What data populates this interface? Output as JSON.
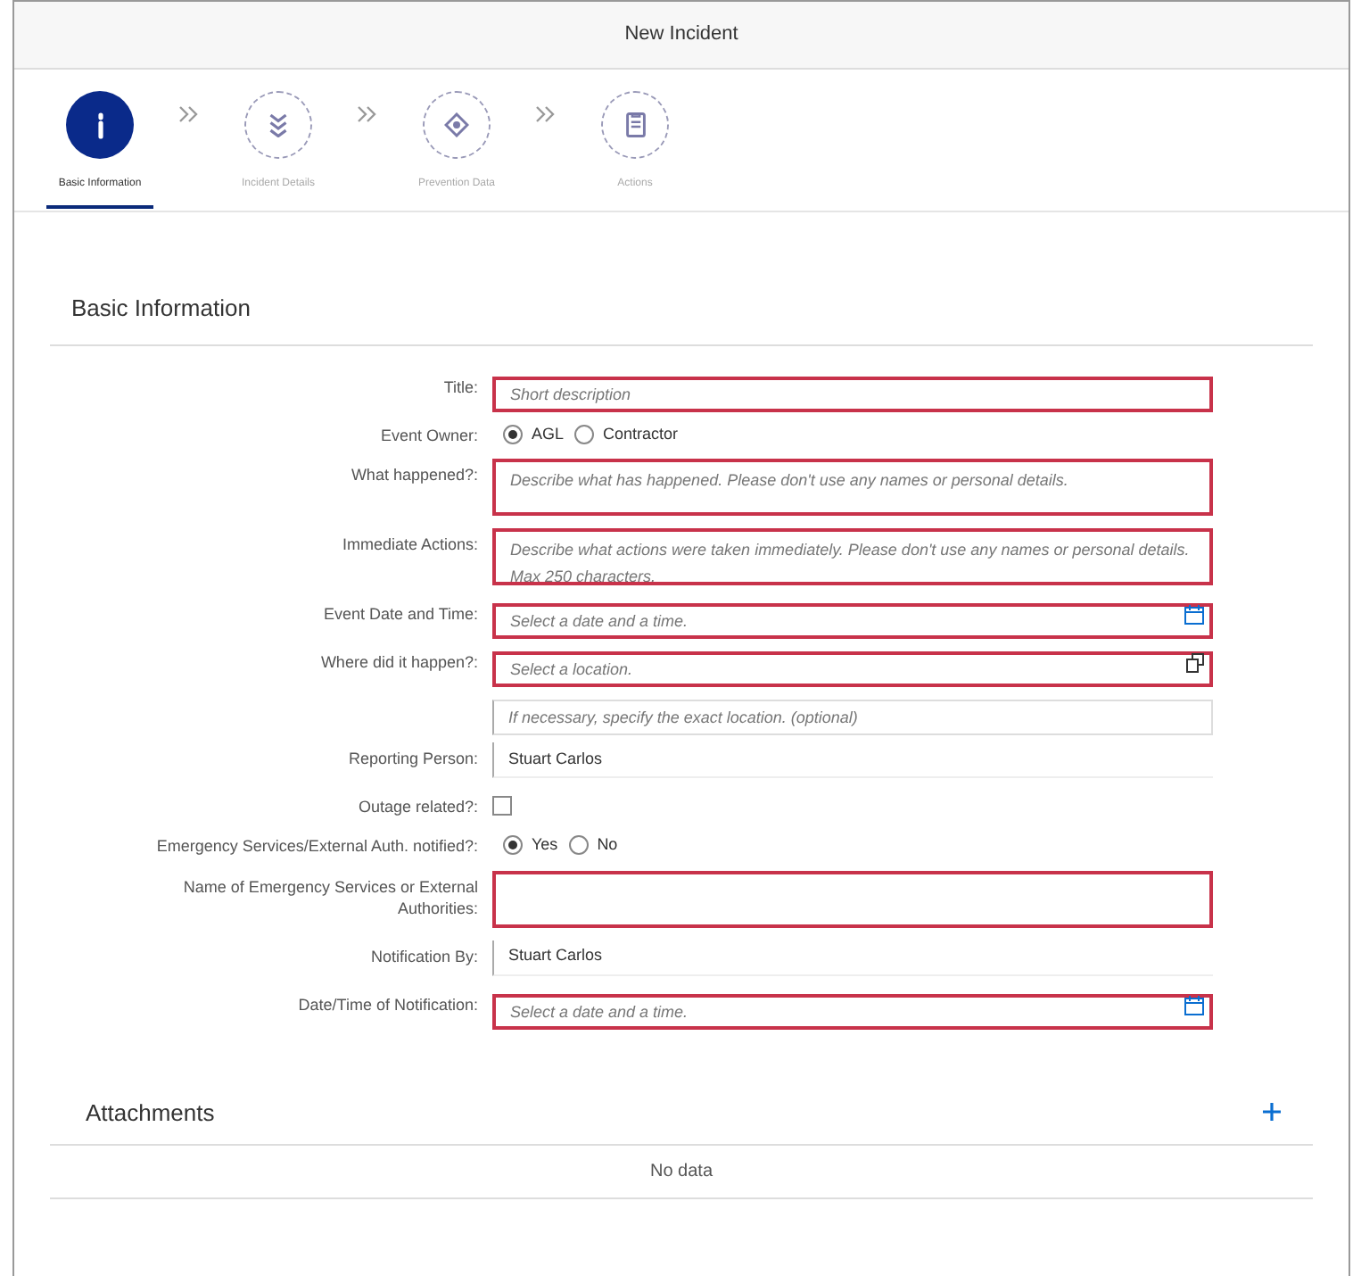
{
  "window": {
    "title": "New Incident"
  },
  "steps": [
    {
      "label": "Basic Information",
      "selected": true
    },
    {
      "label": "Incident Details",
      "selected": false
    },
    {
      "label": "Prevention Data",
      "selected": false
    },
    {
      "label": "Actions",
      "selected": false
    }
  ],
  "section": {
    "title": "Basic Information"
  },
  "fields": [
    {
      "kind": "text",
      "label": "Title:",
      "placeholder": "Short description",
      "invalid": true
    },
    {
      "kind": "radio",
      "label": "Event Owner:",
      "options": [
        {
          "label": "AGL",
          "selected": true
        },
        {
          "label": "Contractor",
          "selected": false
        }
      ]
    },
    {
      "kind": "textarea",
      "label": "What happened?:",
      "placeholder": "Describe what has happened. Please don't use any names or personal details.",
      "invalid": true
    },
    {
      "kind": "textarea",
      "label": "Immediate Actions:",
      "placeholder": "Describe what actions were taken immediately. Please don't use any names or personal details. Max 250 characters.",
      "invalid": true
    },
    {
      "kind": "date",
      "label": "Event Date and Time:",
      "placeholder": "Select a date and a time.",
      "invalid": true
    },
    {
      "kind": "location",
      "label": "Where did it happen?:",
      "placeholder": "Select a location.",
      "invalid": true
    },
    {
      "kind": "text",
      "placeholder": "If necessary, specify the exact location. (optional)",
      "invalid": false
    },
    {
      "kind": "readonly",
      "label": "Reporting Person:",
      "value": "Stuart Carlos"
    },
    {
      "kind": "checkbox",
      "label": "Outage related?:",
      "checked": false
    },
    {
      "kind": "radio",
      "label": "Emergency Services/External Auth. notified?:",
      "options": [
        {
          "label": "Yes",
          "selected": true
        },
        {
          "label": "No",
          "selected": false
        }
      ]
    },
    {
      "kind": "textarea",
      "label": "Name of Emergency Services or External Authorities:",
      "invalid": true
    },
    {
      "kind": "readonly",
      "label": "Notification By:",
      "value": "Stuart Carlos"
    },
    {
      "kind": "date",
      "label": "Date/Time of Notification:",
      "placeholder": "Select a date and a time.",
      "invalid": true
    }
  ],
  "attachments": {
    "title": "Attachments",
    "empty_text": "No data"
  }
}
